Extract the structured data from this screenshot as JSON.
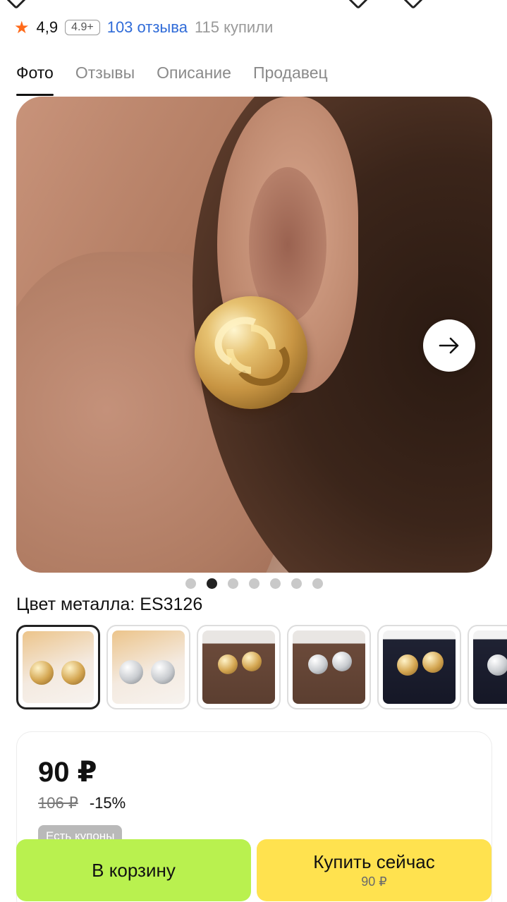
{
  "header": {
    "rating": "4,9",
    "badge": "4.9+",
    "reviews_link": "103 отзыва",
    "bought": "115 купили"
  },
  "tabs": [
    {
      "label": "Фото",
      "active": true
    },
    {
      "label": "Отзывы",
      "active": false
    },
    {
      "label": "Описание",
      "active": false
    },
    {
      "label": "Продавец",
      "active": false
    }
  ],
  "gallery": {
    "next_icon": "arrow-right-icon",
    "dots_total": 7,
    "dots_active_index": 1
  },
  "variant": {
    "label": "Цвет металла: ES3126",
    "thumbnails": [
      {
        "name": "gold-on-card",
        "selected": true
      },
      {
        "name": "silver-on-card",
        "selected": false
      },
      {
        "name": "gold-on-brown-box",
        "selected": false
      },
      {
        "name": "silver-on-brown-box",
        "selected": false
      },
      {
        "name": "gold-on-dark-box",
        "selected": false
      },
      {
        "name": "silver-on-dark-box",
        "selected": false
      }
    ]
  },
  "price_card": {
    "price": "90 ₽",
    "old_price": "106 ₽",
    "discount": "-15%",
    "coupons_badge": "Есть купоны"
  },
  "actions": {
    "add_to_cart": "В корзину",
    "buy_now": "Купить сейчас",
    "buy_now_price": "90 ₽"
  },
  "colors": {
    "cart_button": "#b9f14f",
    "buy_button": "#ffe24f",
    "link_blue": "#2f6bd8",
    "star_orange": "#ff6a1a"
  }
}
